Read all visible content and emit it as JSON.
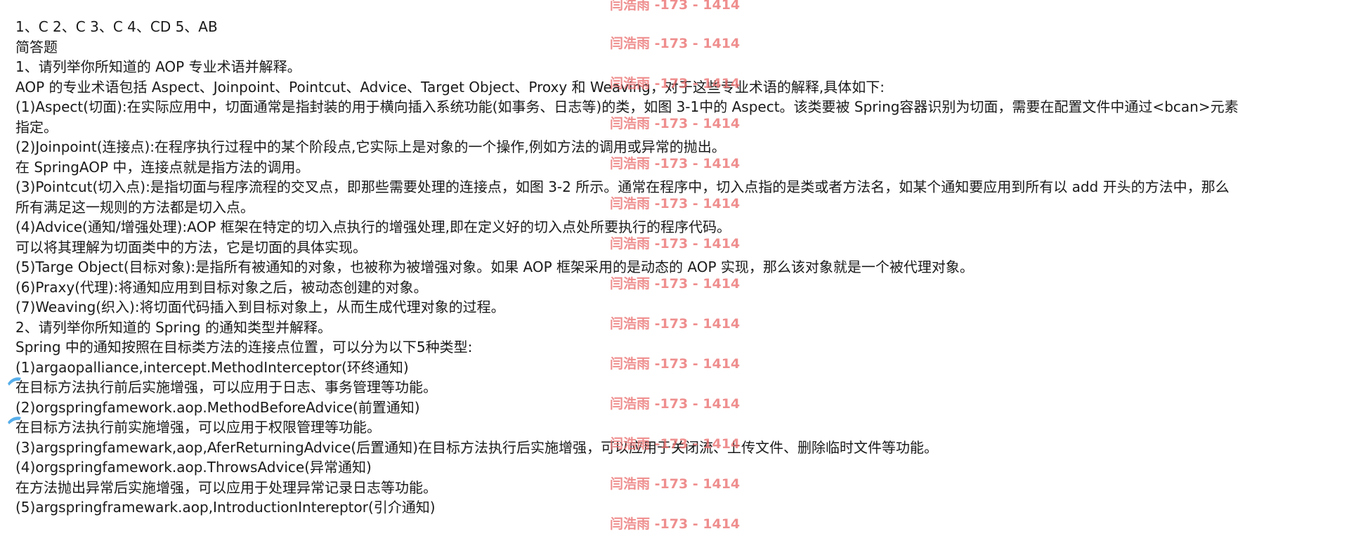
{
  "lines": [
    "1、C  2、C  3、C 4、CD 5、AB",
    "简答题",
    "1、请列举你所知道的 AOP 专业术语并解释。",
    "AOP 的专业术语包括 Aspect、Joinpoint、Pointcut、Advice、Target Object、Proxy 和 Weaving，对于这些专业术语的解释,具体如下:",
    "(1)Aspect(切面):在实际应用中，切面通常是指封装的用于横向插入系统功能(如事务、日志等)的类，如图 3-1中的 Aspect。该类要被 Spring容器识别为切面，需要在配置文件中通过<bcan>元素",
    "指定。",
    "(2)Joinpoint(连接点):在程序执行过程中的某个阶段点,它实际上是对象的一个操作,例如方法的调用或异常的抛出。",
    "在 SpringAOP 中，连接点就是指方法的调用。",
    "(3)Pointcut(切入点):是指切面与程序流程的交叉点，即那些需要处理的连接点，如图 3-2 所示。通常在程序中，切入点指的是类或者方法名，如某个通知要应用到所有以 add 开头的方法中，那么",
    "所有满足这一规则的方法都是切入点。",
    "(4)Advice(通知/增强处理):AOP 框架在特定的切入点执行的增强处理,即在定义好的切入点处所要执行的程序代码。",
    "可以将其理解为切面类中的方法，它是切面的具体实现。",
    "(5)Targe Object(目标对象):是指所有被通知的对象，也被称为被增强对象。如果 AOP 框架采用的是动态的 AOP 实现，那么该对象就是一个被代理对象。",
    "(6)Praxy(代理):将通知应用到目标对象之后，被动态创建的对象。",
    "(7)Weaving(织入):将切面代码插入到目标对象上，从而生成代理对象的过程。",
    "2、请列举你所知道的 Spring 的通知类型并解释。",
    "Spring 中的通知按照在目标类方法的连接点位置，可以分为以下5种类型:",
    "(1)argaopalliance,intercept.MethodInterceptor(环终通知)",
    "在目标方法执行前后实施增强，可以应用于日志、事务管理等功能。",
    "(2)orgspringfamework.aop.MethodBeforeAdvice(前置通知)",
    "在目标方法执行前实施增强，可以应用于权限管理等功能。",
    "(3)argspringfamewark,aop,AferReturningAdvice(后置通知)在目标方法执行后实施增强，可以应用于关闭流、上传文件、删除临时文件等功能。",
    "(4)orgspringfamework.aop.ThrowsAdvice(异常通知)",
    "在方法抛出异常后实施增强，可以应用于处理异常记录日志等功能。",
    "(5)argspringframewark.aop,IntroductionIntereptor(引介通知)"
  ],
  "watermark": "闫浩雨 -173 - 1414",
  "colors": {
    "text": "#1a1a1a",
    "watermark": "#eb6e6e",
    "pen_mark": "#3aa0e6"
  }
}
